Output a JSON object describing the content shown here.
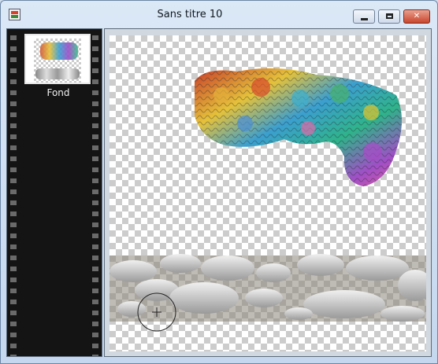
{
  "window": {
    "title": "Sans titre 10",
    "buttons": {
      "minimize": "",
      "maximize": "",
      "close": "✕"
    }
  },
  "layers": {
    "items": [
      {
        "label": "Fond"
      }
    ]
  },
  "canvas": {
    "background": "transparency-checkerboard",
    "objects": [
      "knitted-yarn-texture",
      "river-stones-strip"
    ],
    "cursor": "brush-crosshair"
  },
  "colors": {
    "titlebar": "#cfdff0",
    "panel": "#141414",
    "checker_dark": "#cccccc",
    "checker_light": "#ffffff",
    "close_button": "#c9452c"
  }
}
